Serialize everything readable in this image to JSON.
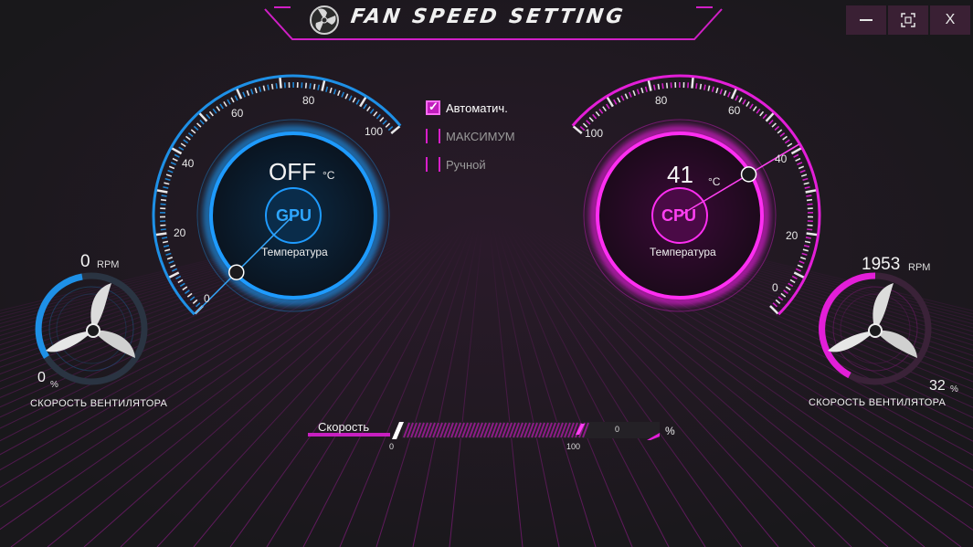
{
  "window": {
    "title": "FAN SPEED SETTING",
    "minimize_icon": "minimize-icon",
    "maximize_icon": "maximize-icon",
    "close_label": "X"
  },
  "colors": {
    "gpu_accent": "#1e90e6",
    "cpu_accent": "#e31ed8",
    "background": "#1b1a1d",
    "titlebar_button": "#3a2034"
  },
  "gpu": {
    "value": "OFF",
    "unit": "°C",
    "chip_label": "GPU",
    "sub_label": "Температура",
    "ticks": [
      "0",
      "20",
      "40",
      "60",
      "80",
      "100"
    ],
    "needle_value": 0
  },
  "cpu": {
    "value": "41",
    "unit": "°C",
    "chip_label": "CPU",
    "sub_label": "Температура",
    "ticks": [
      "0",
      "20",
      "40",
      "60",
      "80",
      "100"
    ],
    "needle_value": 41
  },
  "modes": [
    {
      "label": "Автоматич.",
      "checked": true
    },
    {
      "label": "МАКСИМУМ",
      "checked": false
    },
    {
      "label": "Ручной",
      "checked": false
    }
  ],
  "gpu_fan": {
    "rpm": "0",
    "rpm_unit": "RPM",
    "percent": "0",
    "percent_unit": "%",
    "label": "СКОРОСТЬ ВЕНТИЛЯТОРА",
    "percent_fraction": 0
  },
  "cpu_fan": {
    "rpm": "1953",
    "rpm_unit": "RPM",
    "percent": "32",
    "percent_unit": "%",
    "label": "СКОРОСТЬ ВЕНТИЛЯТОРА",
    "percent_fraction": 0.32
  },
  "speed": {
    "label": "Скорость",
    "value": "0",
    "unit": "%",
    "min_label": "0",
    "max_label": "100"
  }
}
